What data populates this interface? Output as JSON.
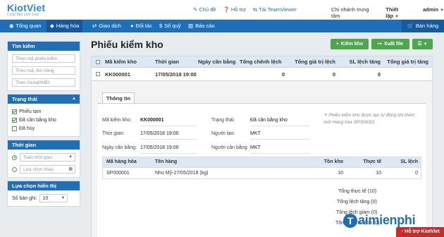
{
  "brand": {
    "name_a": "Kiot",
    "name_b": "Viet",
    "tagline": "Cùng Bạn Làm Giàu"
  },
  "topbar": {
    "theme": "Chủ đề",
    "support": "Hỗ trợ",
    "teamviewer": "Tải TeamViewer",
    "branch": "Chi nhánh trung tâm",
    "settings": "Thiết lập",
    "user": "admin"
  },
  "nav": {
    "items": [
      "Tổng quan",
      "Hàng hóa",
      "Giao dịch",
      "Đối tác",
      "Sổ quỹ",
      "Báo cáo"
    ],
    "active_index": 1,
    "sale": "Bán hàng"
  },
  "sidebar": {
    "search": {
      "title": "Tìm kiếm",
      "placeholders": [
        "Theo mã phiếu kiểm",
        "Theo mã, tên hàng",
        "Theo Serial/IMEI"
      ]
    },
    "status": {
      "title": "Trạng thái",
      "options": [
        {
          "label": "Phiếu tạm",
          "checked": true
        },
        {
          "label": "Đã cân bằng kho",
          "checked": true
        },
        {
          "label": "Đã hủy",
          "checked": false
        }
      ]
    },
    "time": {
      "title": "Thời gian",
      "options": [
        {
          "label": "Toàn thời gian",
          "selected": true
        },
        {
          "label": "Lựa chọn khác",
          "selected": false
        }
      ]
    },
    "display": {
      "title": "Lựa chọn hiển thị",
      "per_page_label": "Số bản ghi:",
      "per_page_value": "10"
    }
  },
  "main": {
    "title": "Phiếu kiểm kho",
    "buttons": {
      "add": "Kiểm kho",
      "export": "Xuất file"
    },
    "columns": [
      "Mã kiểm kho",
      "Thời gian",
      "Ngày cân bằng",
      "Tổng chênh lệch",
      "Tổng giá trị lệch",
      "SL lệch tăng",
      "Tổng giá trị tăng"
    ],
    "rows": [
      {
        "code": "KK000001",
        "time": "17/05/2018 19:00",
        "balance_date": "",
        "total_diff": "0",
        "total_diff_value": "0",
        "qty_up": "0",
        "value_up": ""
      }
    ],
    "detail": {
      "tab": "Thông tin",
      "labels": {
        "code": "Mã kiểm kho:",
        "time": "Thời gian:",
        "balance_date": "Ngày cân bằng:",
        "status": "Trạng thái:",
        "creator": "Người tạo:",
        "balancer": "Người cân bằng:"
      },
      "values": {
        "code": "KK000001",
        "time": "17/05/2018 19:00",
        "balance_date": "17/05/2018 19:00",
        "status": "Đã cân bằng kho",
        "creator": "MKT",
        "balancer": "MKT"
      },
      "note": "Phiếu kiểm kho được tạo tự động khi thêm mới Hàng hóa SP000001",
      "columns": [
        "Mã hàng hóa",
        "Tên hàng",
        "Tồn kho",
        "Thực tế",
        "SL lệch"
      ],
      "items": [
        {
          "code": "SP000001",
          "name": "Nho Mỹ-27/05/2018 (kg)",
          "stock": "10",
          "actual": "10",
          "diff": "0"
        }
      ],
      "totals": [
        "Tổng thực tế (10)",
        "Tổng lệch tăng (0)",
        "Tổng lệch giảm (0)",
        "Tổng chênh lệch (0)"
      ]
    }
  },
  "watermark": {
    "prefix": "T",
    "text_a": "aimien",
    "text_b": "phi"
  },
  "support_bar": "Hỗ trợ KiotViet"
}
